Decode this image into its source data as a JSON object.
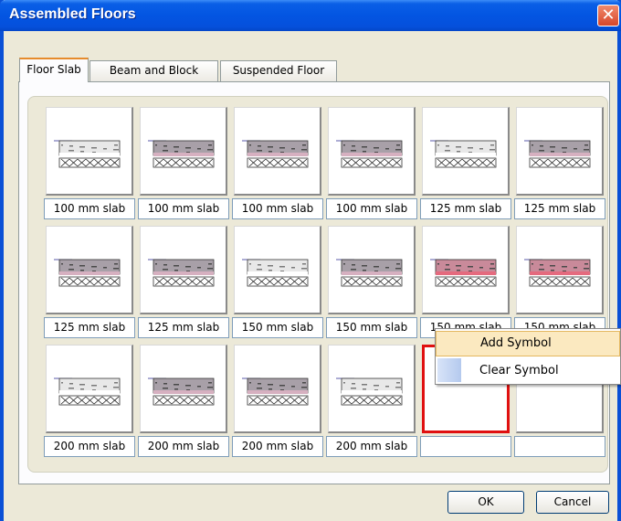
{
  "window": {
    "title": "Assembled Floors"
  },
  "tabs": [
    {
      "label": "Floor Slab",
      "active": true
    },
    {
      "label": "Beam and Block",
      "active": false
    },
    {
      "label": "Suspended Floor",
      "active": false
    }
  ],
  "cells": [
    {
      "label": "100 mm slab",
      "style": "a"
    },
    {
      "label": "100 mm slab",
      "style": "b"
    },
    {
      "label": "100 mm slab",
      "style": "b"
    },
    {
      "label": "100 mm slab",
      "style": "b"
    },
    {
      "label": "125 mm slab",
      "style": "a"
    },
    {
      "label": "125 mm slab",
      "style": "b"
    },
    {
      "label": "125 mm slab",
      "style": "b"
    },
    {
      "label": "125 mm slab",
      "style": "b"
    },
    {
      "label": "150 mm slab",
      "style": "a"
    },
    {
      "label": "150 mm slab",
      "style": "b"
    },
    {
      "label": "150 mm slab",
      "style": "c"
    },
    {
      "label": "150 mm slab",
      "style": "c"
    },
    {
      "label": "200 mm slab",
      "style": "a"
    },
    {
      "label": "200 mm slab",
      "style": "b"
    },
    {
      "label": "200 mm slab",
      "style": "b"
    },
    {
      "label": "200 mm slab",
      "style": "a"
    },
    {
      "label": "",
      "style": "empty",
      "selected": true
    },
    {
      "label": "",
      "style": "empty"
    }
  ],
  "context_menu": {
    "items": [
      {
        "label": "Add Symbol",
        "highlighted": true
      },
      {
        "label": "Clear Symbol",
        "highlighted": false
      }
    ]
  },
  "buttons": {
    "ok": "OK",
    "cancel": "Cancel"
  },
  "colors": {
    "titlebar": "#0355e2",
    "selection": "#e01010",
    "menu_highlight": "#fbe9c0"
  }
}
